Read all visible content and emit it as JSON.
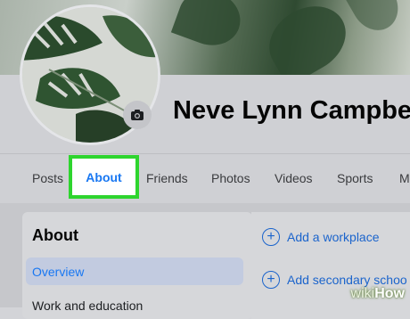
{
  "profile": {
    "name": "Neve Lynn Campbel"
  },
  "tabs": [
    {
      "label": "Posts"
    },
    {
      "label": "About",
      "selected": true
    },
    {
      "label": "Friends"
    },
    {
      "label": "Photos"
    },
    {
      "label": "Videos"
    },
    {
      "label": "Sports"
    },
    {
      "label": "M"
    }
  ],
  "about_panel": {
    "heading": "About",
    "items": [
      {
        "label": "Overview",
        "active": true
      },
      {
        "label": "Work and education"
      }
    ]
  },
  "actions": [
    {
      "label": "Add a workplace",
      "icon": "plus-circle-icon"
    },
    {
      "label": "Add secondary schoo",
      "icon": "plus-circle-icon"
    }
  ],
  "watermark": {
    "prefix": "wiki",
    "suffix": "How"
  },
  "colors": {
    "highlight": "#2ed52e",
    "link_blue": "#1877f2"
  }
}
